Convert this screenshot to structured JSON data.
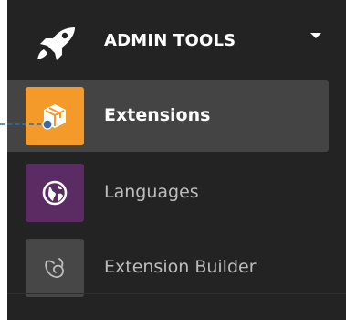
{
  "header": {
    "title": "ADMIN TOOLS",
    "icon": "rocket-icon",
    "expand_icon": "caret-down-icon"
  },
  "menu": {
    "items": [
      {
        "label": "Extensions",
        "icon": "cube-icon",
        "color": "#f49a2a",
        "active": true
      },
      {
        "label": "Languages",
        "icon": "globe-icon",
        "color": "#5b2b63",
        "active": false
      },
      {
        "label": "Extension Builder",
        "icon": "joomla-logo-icon",
        "color": "#474747",
        "active": false
      }
    ]
  },
  "colors": {
    "menu_background": "#232323",
    "active_item_background": "#444444",
    "callout": "#3a6aa3"
  }
}
